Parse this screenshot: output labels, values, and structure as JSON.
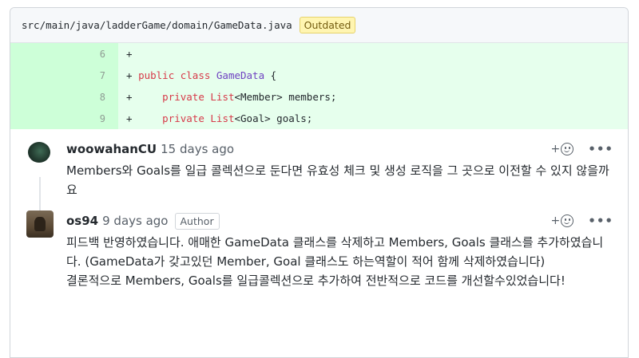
{
  "file": {
    "path": "src/main/java/ladderGame/domain/GameData.java",
    "badge": "Outdated"
  },
  "diff": {
    "lines": [
      {
        "num": "6",
        "prefix": "+",
        "code": ""
      },
      {
        "num": "7",
        "prefix": "+",
        "code": " public class GameData {"
      },
      {
        "num": "8",
        "prefix": "+",
        "code": "     private List<Member> members;"
      },
      {
        "num": "9",
        "prefix": "+",
        "code": "     private List<Goal> goals;"
      }
    ]
  },
  "comments": [
    {
      "author": "woowahanCU",
      "time": "15 days ago",
      "badge": "",
      "avatar_icon": "user-avatar",
      "react_plus": "+",
      "more": "•••",
      "text": [
        "Members와 Goals를 일급 콜렉션으로 둔다면 유효성 체크 및 생성 로직을 그 곳으로 이전할 수 있지 않을까요"
      ]
    },
    {
      "author": "os94",
      "time": "9 days ago",
      "badge": "Author",
      "avatar_icon": "user-avatar",
      "react_plus": "+",
      "more": "•••",
      "text": [
        "피드백 반영하였습니다. 애매한 GameData 클래스를 삭제하고 Members, Goals 클래스를 추가하였습니다. (GameData가 갖고있던 Member, Goal 클래스도 하는역할이 적어 함께 삭제하였습니다)",
        "결론적으로 Members, Goals를 일급콜렉션으로 추가하여 전반적으로 코드를 개선할수있었습니다!"
      ]
    }
  ],
  "colors": {
    "diff_bg": "#e6ffed",
    "diff_gutter": "#cdffd8",
    "keyword": "#d73a49",
    "type": "#6f42c1",
    "outdated_bg": "#fff5b1"
  }
}
